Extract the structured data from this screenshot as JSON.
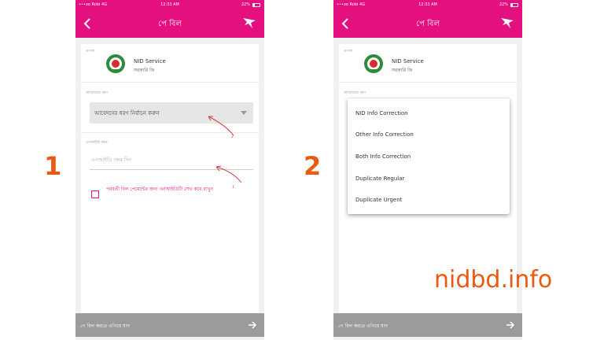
{
  "colors": {
    "brand": "#e4107f",
    "accent_orange": "#ec5a12",
    "bottom_bar": "#9b9b9b"
  },
  "status_bar": {
    "carrier": "•••oo Robi 4G  ",
    "time": "12:33 AM",
    "battery": "22%"
  },
  "app_bar": {
    "title": "পে বিল",
    "back_icon": "chevron-left-icon",
    "logo_icon": "bird-logo-icon"
  },
  "biller": {
    "caption": "প্রাপক",
    "name": "NID Service",
    "subtitle": "সরকারি ফি"
  },
  "application_type": {
    "caption": "আবেদনের ধরণ",
    "placeholder": "আবেদনের ধরণ নির্বাচন করুন"
  },
  "nid_number": {
    "caption": "এনআইডি নম্বর",
    "placeholder": "এনআইডি নম্বর দিন"
  },
  "save_checkbox": {
    "label": "পরবর্তী বিল পেমেন্টের জন্য এনআইডিটি সেভ করে রাখুন",
    "checked": false
  },
  "annotations": {
    "mark_select": "2",
    "mark_input": "1"
  },
  "bottom_bar": {
    "label": "পে বিল করতে এগিয়ে যান",
    "arrow_icon": "arrow-right-icon"
  },
  "dropdown": {
    "options": [
      "NID Info Correction",
      "Other Info Correction",
      "Both Info Correction",
      "Duplicate Regular",
      "Duplicate Urgent"
    ]
  },
  "step_labels": {
    "first": "1",
    "second": "2"
  },
  "watermark": "nidbd.info"
}
